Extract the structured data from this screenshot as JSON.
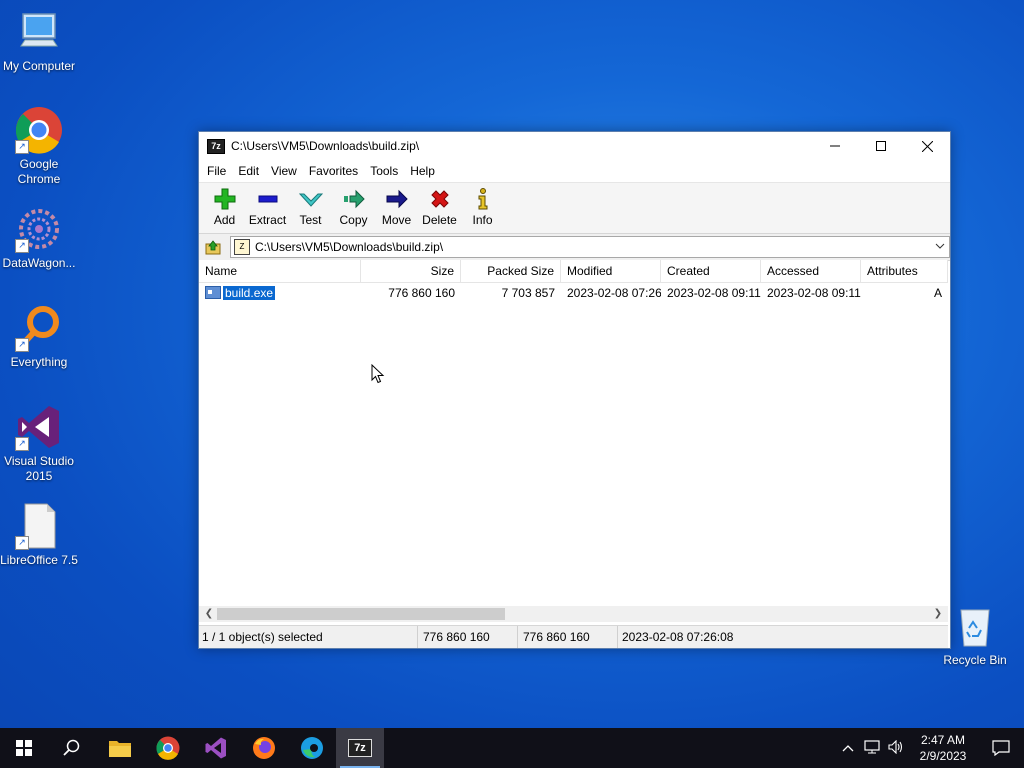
{
  "desktop": {
    "icons": [
      {
        "label": "My Computer"
      },
      {
        "label": "Google Chrome"
      },
      {
        "label": "DataWagon..."
      },
      {
        "label": "Everything"
      },
      {
        "label": "Visual Studio 2015"
      },
      {
        "label": "LibreOffice 7.5"
      },
      {
        "label": "Recycle Bin"
      }
    ]
  },
  "window": {
    "title": "C:\\Users\\VM5\\Downloads\\build.zip\\",
    "app_icon_text": "7z",
    "menu": [
      "File",
      "Edit",
      "View",
      "Favorites",
      "Tools",
      "Help"
    ],
    "toolbar": [
      "Add",
      "Extract",
      "Test",
      "Copy",
      "Move",
      "Delete",
      "Info"
    ],
    "address": "C:\\Users\\VM5\\Downloads\\build.zip\\",
    "columns": [
      "Name",
      "Size",
      "Packed Size",
      "Modified",
      "Created",
      "Accessed",
      "Attributes"
    ],
    "rows": [
      {
        "name": "build.exe",
        "size": "776 860 160",
        "packed": "7 703 857",
        "modified": "2023-02-08 07:26",
        "created": "2023-02-08 09:11",
        "accessed": "2023-02-08 09:11",
        "attributes": "A"
      }
    ],
    "status": {
      "selected": "1 / 1 object(s) selected",
      "size": "776 860 160",
      "packed": "776 860 160",
      "modified": "2023-02-08 07:26:08"
    }
  },
  "taskbar": {
    "time": "2:47 AM",
    "date": "2/9/2023",
    "active_app_text": "7z"
  },
  "colors": {
    "selection": "#0a68d0",
    "desktop": "#1467d6"
  }
}
